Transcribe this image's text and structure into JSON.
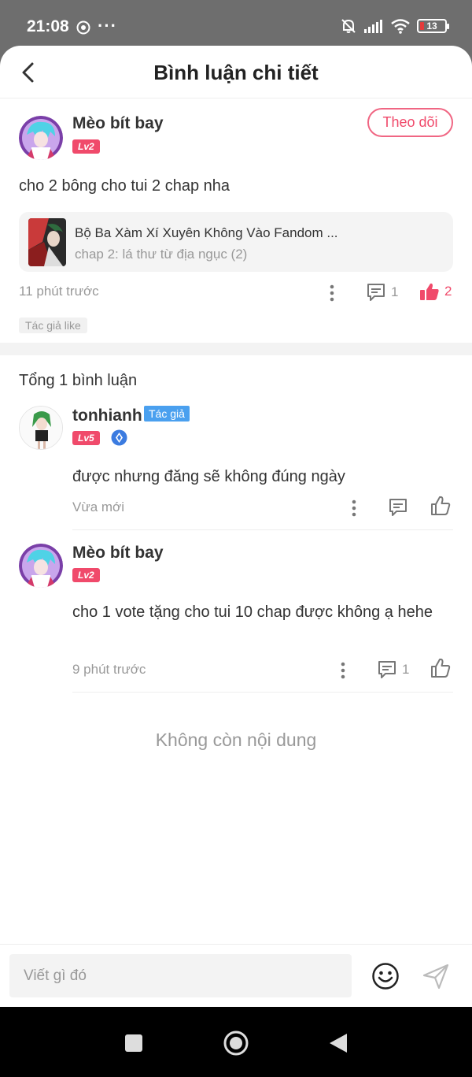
{
  "status_bar": {
    "time": "21:08",
    "dots": "···",
    "battery": "13"
  },
  "header": {
    "title": "Bình luận chi tiết"
  },
  "main_comment": {
    "user": "Mèo bít bay",
    "level": "Lv2",
    "follow_label": "Theo dõi",
    "text": "cho 2 bông cho tui 2 chap nha",
    "book": {
      "title": "Bộ Ba Xàm Xí Xuyên Không Vào Fandom ...",
      "chapter": "chap 2: lá thư từ địa ngục (2)"
    },
    "time": "11 phút trước",
    "reply_count": "1",
    "like_count": "2",
    "author_liked": "Tác giả like"
  },
  "replies_header": "Tổng 1 bình luận",
  "replies": [
    {
      "user": "tonhianh",
      "author_tag": "Tác giả",
      "level": "Lv5",
      "text": "được nhưng đăng sẽ không đúng ngày",
      "time": "Vừa mới"
    },
    {
      "user": "Mèo bít bay",
      "level": "Lv2",
      "text": "cho 1 vote tặng cho tui 10 chap được không ạ hehe",
      "time": "9 phút trước",
      "reply_count": "1"
    }
  ],
  "end_text": "Không còn nội dung",
  "input": {
    "placeholder": "Viết gì đó"
  },
  "colors": {
    "accent": "#f04a6b",
    "author_tag": "#4aa0ef",
    "muted": "#999999"
  },
  "icons": [
    "back-icon",
    "more-icon",
    "comment-icon",
    "thumbs-up-icon",
    "emoji-icon",
    "send-icon"
  ]
}
